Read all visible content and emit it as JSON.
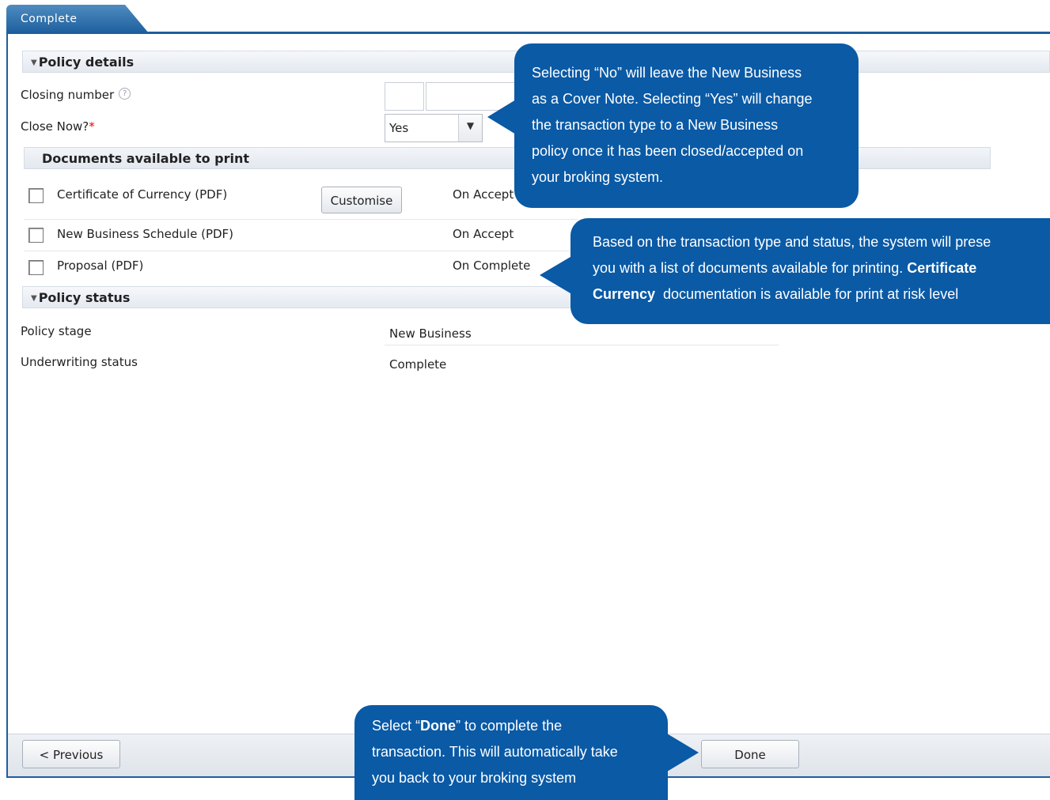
{
  "tab": {
    "title": "Complete"
  },
  "policy_details": {
    "heading": "Policy details",
    "closing_number_label": "Closing number",
    "close_now_label": "Close Now?",
    "close_now_required": "*",
    "close_now_value": "Yes"
  },
  "documents": {
    "heading": "Documents available to print",
    "customise_label": "Customise",
    "items": [
      {
        "name": "Certificate of Currency (PDF)",
        "status": "On Accept"
      },
      {
        "name": "New Business Schedule (PDF)",
        "status": "On Accept"
      },
      {
        "name": "Proposal (PDF)",
        "status": "On Complete"
      }
    ]
  },
  "policy_status": {
    "heading": "Policy status",
    "stage_label": "Policy stage",
    "stage_value": "New Business",
    "uw_label": "Underwriting status",
    "uw_value": "Complete"
  },
  "footer": {
    "previous_label": "< Previous",
    "done_label": "Done"
  },
  "callouts": {
    "close_now": {
      "line1": "Selecting “No” will leave the New Business",
      "line2": "as a Cover Note. Selecting “Yes” will change",
      "line3": "the transaction type to a New Business",
      "line4": "policy once it has been closed/accepted on",
      "line5": "your broking system."
    },
    "documents": {
      "line1": "Based on the transaction type and status, the system will prese",
      "line2_pre": "you with a list of documents available for printing. ",
      "line2_bold": "Certificate",
      "line3_bold": "Currency",
      "line3_post": "  documentation is available for print at risk level"
    },
    "done": {
      "line1_pre": "Select “",
      "line1_bold": "Done",
      "line1_post": "” to complete the",
      "line2": "transaction. This will automatically take",
      "line3": "you back to your broking system"
    }
  },
  "colors": {
    "accent": "#1d5f9e",
    "callout": "#0a5aa6",
    "required": "#e00000"
  },
  "icons": [
    "help-icon",
    "dropdown-arrow-icon",
    "collapse-triangle-icon"
  ]
}
